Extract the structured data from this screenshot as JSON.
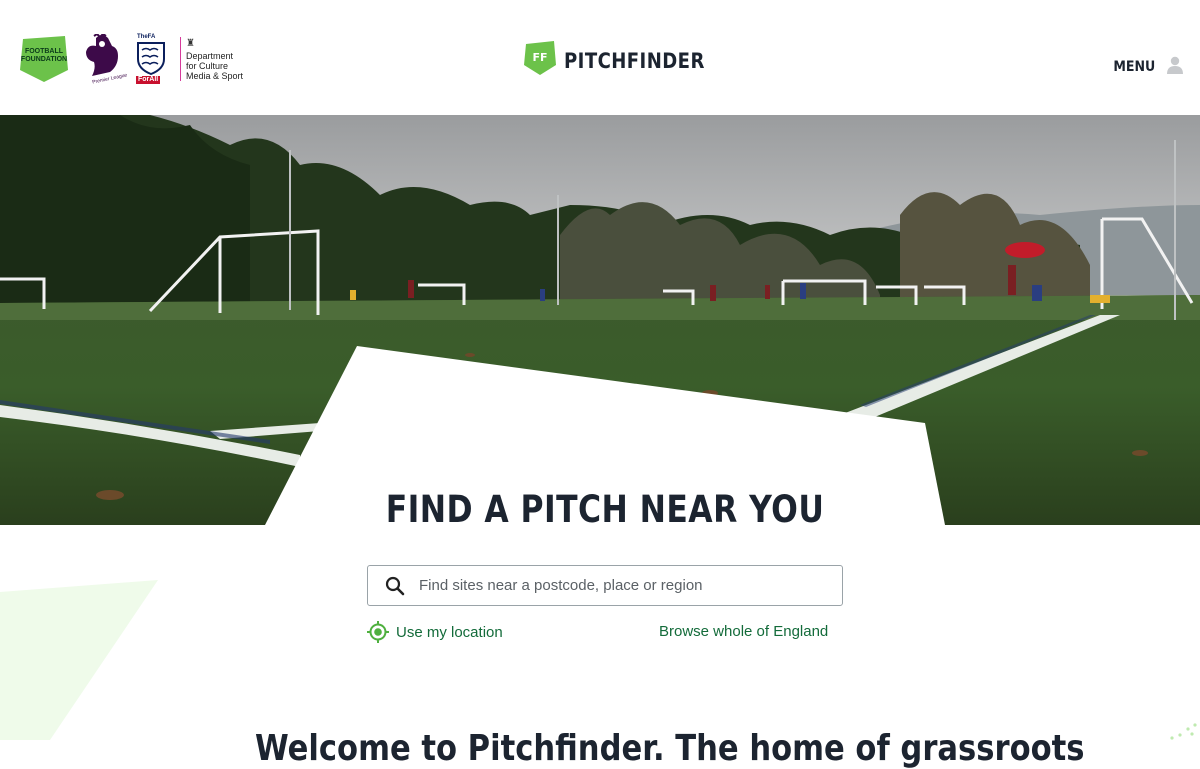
{
  "header": {
    "partner_logos": [
      {
        "name": "Football Foundation",
        "text": "FOOTBALL\nFOUNDATION"
      },
      {
        "name": "Premier League",
        "text": "Premier League"
      },
      {
        "name": "The FA",
        "text_top": "TheFA",
        "text_bottom": "ForAll"
      },
      {
        "name": "Department for Culture Media & Sport",
        "text": "Department\nfor Culture\nMedia & Sport"
      }
    ],
    "brand": {
      "monogram": "FF",
      "name": "PITCHFINDER"
    },
    "menu_label": "MENU"
  },
  "hero": {
    "image": "artificial grass football pitch with goals, players and trees under cloudy sky"
  },
  "search_section": {
    "title": "FIND A PITCH NEAR YOU",
    "search_placeholder": "Find sites near a postcode, place or region",
    "use_location_label": "Use my location",
    "browse_label": "Browse whole of England"
  },
  "welcome_heading_partial": "Welcome to Pitchfinder. The home of grassroots",
  "colors": {
    "brand_green": "#6cc24a",
    "link_green": "#136b3a",
    "dark_text": "#1c2430",
    "pale_green_deco": "#eefbe9"
  },
  "icons": [
    "search-icon",
    "location-target-icon",
    "user-icon"
  ]
}
